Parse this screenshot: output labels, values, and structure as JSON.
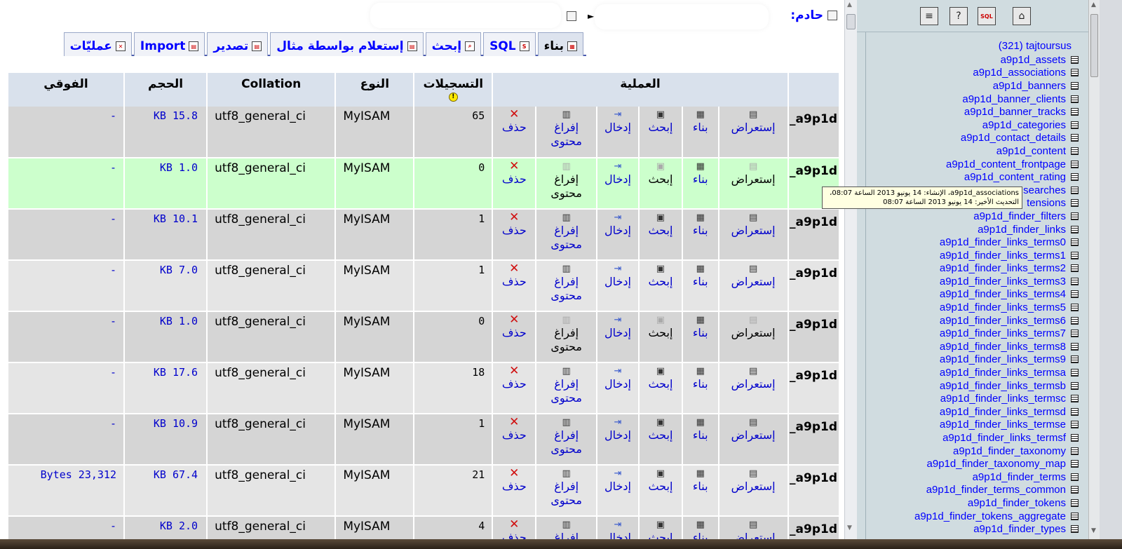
{
  "header": {
    "server_label": "حادم:",
    "separator": "►"
  },
  "tabs": [
    {
      "label": "بناء",
      "icon": "structure-icon",
      "active": true
    },
    {
      "label": "SQL",
      "icon": "sql-icon"
    },
    {
      "label": "إبحث",
      "icon": "search-icon"
    },
    {
      "label": "إستعلام بواسطة مثال",
      "icon": "query-icon"
    },
    {
      "label": "تصدير",
      "icon": "export-icon"
    },
    {
      "label": "Import",
      "icon": "import-icon"
    },
    {
      "label": "عمليّات",
      "icon": "operations-icon"
    }
  ],
  "table": {
    "headers": {
      "action": "العملية",
      "records": "التسجيلات",
      "type": "النوع",
      "collation": "Collation",
      "size": "الحجم",
      "overhead": "الفوقي"
    },
    "ops": {
      "browse": "إستعراض",
      "structure": "بناء",
      "search": "إبحث",
      "insert": "إدخال",
      "empty1": "إفراغ",
      "empty2": "محتوى",
      "drop": "حذف"
    },
    "rows": [
      {
        "name": "a9p1d_",
        "records": "65",
        "type": "MyISAM",
        "collation": "utf8_general_ci",
        "size": "KB 15.8",
        "overhead": "-",
        "disabled": false
      },
      {
        "name": "a9p1d_",
        "records": "0",
        "type": "MyISAM",
        "collation": "utf8_general_ci",
        "size": "KB 1.0",
        "overhead": "-",
        "disabled": true
      },
      {
        "name": "a9p1d_",
        "records": "1",
        "type": "MyISAM",
        "collation": "utf8_general_ci",
        "size": "KB 10.1",
        "overhead": "-",
        "disabled": false
      },
      {
        "name": "a9p1d_",
        "records": "1",
        "type": "MyISAM",
        "collation": "utf8_general_ci",
        "size": "KB 7.0",
        "overhead": "-",
        "disabled": false
      },
      {
        "name": "a9p1d_",
        "records": "0",
        "type": "MyISAM",
        "collation": "utf8_general_ci",
        "size": "KB 1.0",
        "overhead": "-",
        "disabled": true
      },
      {
        "name": "a9p1d_",
        "records": "18",
        "type": "MyISAM",
        "collation": "utf8_general_ci",
        "size": "KB 17.6",
        "overhead": "-",
        "disabled": false
      },
      {
        "name": "a9p1d_",
        "records": "1",
        "type": "MyISAM",
        "collation": "utf8_general_ci",
        "size": "KB 10.9",
        "overhead": "-",
        "disabled": false
      },
      {
        "name": "a9p1d_",
        "records": "21",
        "type": "MyISAM",
        "collation": "utf8_general_ci",
        "size": "KB 67.4",
        "overhead": "Bytes 23,312",
        "disabled": false
      },
      {
        "name": "a9p1d_",
        "records": "4",
        "type": "MyISAM",
        "collation": "utf8_general_ci",
        "size": "KB 2.0",
        "overhead": "-",
        "disabled": false
      }
    ]
  },
  "tooltip": {
    "line1": "a9p1d_associations، الإنشاء: 14 يونيو 2013 الساعة 08:07،",
    "line2": "التحديث الأخير: 14 يونيو 2013 الساعة 08:07"
  },
  "nav": {
    "db_name": "(321) tajtoursus",
    "tables": [
      "a9p1d_assets",
      "a9p1d_associations",
      "a9p1d_banners",
      "a9p1d_banner_clients",
      "a9p1d_banner_tracks",
      "a9p1d_categories",
      "a9p1d_contact_details",
      "a9p1d_content",
      "a9p1d_content_frontpage",
      "a9p1d_content_rating",
      "searches",
      "tensions",
      "a9p1d_finder_filters",
      "a9p1d_finder_links",
      "a9p1d_finder_links_terms0",
      "a9p1d_finder_links_terms1",
      "a9p1d_finder_links_terms2",
      "a9p1d_finder_links_terms3",
      "a9p1d_finder_links_terms4",
      "a9p1d_finder_links_terms5",
      "a9p1d_finder_links_terms6",
      "a9p1d_finder_links_terms7",
      "a9p1d_finder_links_terms8",
      "a9p1d_finder_links_terms9",
      "a9p1d_finder_links_termsa",
      "a9p1d_finder_links_termsb",
      "a9p1d_finder_links_termsc",
      "a9p1d_finder_links_termsd",
      "a9p1d_finder_links_termse",
      "a9p1d_finder_links_termsf",
      "a9p1d_finder_taxonomy",
      "a9p1d_finder_taxonomy_map",
      "a9p1d_finder_terms",
      "a9p1d_finder_terms_common",
      "a9p1d_finder_tokens",
      "a9p1d_finder_tokens_aggregate",
      "a9p1d_finder_types"
    ],
    "buttons": [
      {
        "label": "⌂",
        "icon": "home-icon"
      },
      {
        "label": "SQL",
        "icon": "sql-window-icon"
      },
      {
        "label": "?",
        "icon": "help-icon"
      },
      {
        "label": "≡",
        "icon": "docs-icon"
      }
    ]
  }
}
